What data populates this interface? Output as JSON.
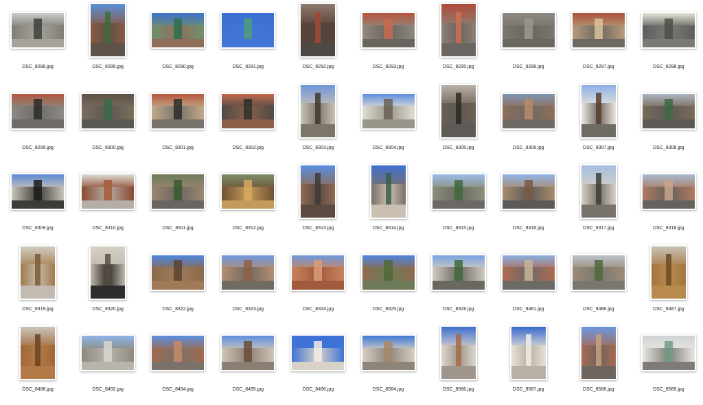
{
  "files": [
    {
      "name": "DSC_8288.jpg",
      "orientation": "land",
      "colors": [
        "#c9c9c6",
        "#7f7e76",
        "#a5a39c"
      ],
      "accent": "#3f3f3a"
    },
    {
      "name": "DSC_8289.jpg",
      "orientation": "port",
      "colors": [
        "#5b8fd6",
        "#8a5a44",
        "#5f5248"
      ],
      "accent": "#3c6e3a"
    },
    {
      "name": "DSC_8290.jpg",
      "orientation": "land",
      "colors": [
        "#3f72c9",
        "#6f8f6f",
        "#8f6f5a"
      ],
      "accent": "#2f6e52"
    },
    {
      "name": "DSC_8291.jpg",
      "orientation": "land",
      "colors": [
        "#3a6fd1",
        "#3f72d3",
        "#4476d6"
      ],
      "accent": "#4d9e7d"
    },
    {
      "name": "DSC_8292.jpg",
      "orientation": "port",
      "colors": [
        "#8d7a70",
        "#5a4236",
        "#4d4844"
      ],
      "accent": "#a24836"
    },
    {
      "name": "DSC_8293.jpg",
      "orientation": "land",
      "colors": [
        "#b5563e",
        "#8f8880",
        "#6a655e"
      ],
      "accent": "#c96b4d"
    },
    {
      "name": "DSC_8295.jpg",
      "orientation": "port",
      "colors": [
        "#b04c38",
        "#8e7f74",
        "#6b6661"
      ],
      "accent": "#d16f4f"
    },
    {
      "name": "DSC_8296.jpg",
      "orientation": "land",
      "colors": [
        "#8c8780",
        "#7a766f",
        "#6a6660"
      ],
      "accent": "#9e988f"
    },
    {
      "name": "DSC_8297.jpg",
      "orientation": "land",
      "colors": [
        "#a9533c",
        "#b59a78",
        "#6d6862"
      ],
      "accent": "#d9c39b"
    },
    {
      "name": "DSC_8298.jpg",
      "orientation": "land",
      "colors": [
        "#e6e2d6",
        "#5c5f5e",
        "#7a7a74"
      ],
      "accent": "#4a5048"
    },
    {
      "name": "DSC_8299.jpg",
      "orientation": "land",
      "colors": [
        "#b1583e",
        "#8c8a84",
        "#6e6b66"
      ],
      "accent": "#2c2c2a"
    },
    {
      "name": "DSC_8300.jpg",
      "orientation": "land",
      "colors": [
        "#5b5246",
        "#7d6d5d",
        "#5a5852"
      ],
      "accent": "#3b6a4a"
    },
    {
      "name": "DSC_8301.jpg",
      "orientation": "land",
      "colors": [
        "#b5583e",
        "#c2a988",
        "#77726b"
      ],
      "accent": "#2e2e2d"
    },
    {
      "name": "DSC_8302.jpg",
      "orientation": "land",
      "colors": [
        "#c0694b",
        "#4e4b45",
        "#8a5f4a"
      ],
      "accent": "#2f2f2c"
    },
    {
      "name": "DSC_8303.jpg",
      "orientation": "port",
      "colors": [
        "#6f96d8",
        "#c8c2b4",
        "#7b7668"
      ],
      "accent": "#3e3a33"
    },
    {
      "name": "DSC_8304.jpg",
      "orientation": "land",
      "colors": [
        "#5f8fe0",
        "#e2ddd3",
        "#9a958b"
      ],
      "accent": "#6b6056"
    },
    {
      "name": "DSC_8305.jpg",
      "orientation": "port",
      "colors": [
        "#b9b2a7",
        "#6a5f52",
        "#5e5a55"
      ],
      "accent": "#2c2a27"
    },
    {
      "name": "DSC_8306.jpg",
      "orientation": "land",
      "colors": [
        "#7e95b3",
        "#8f6e58",
        "#6d6a66"
      ],
      "accent": "#b98a68"
    },
    {
      "name": "DSC_8307.jpg",
      "orientation": "port",
      "colors": [
        "#8fb0e6",
        "#ebe6dc",
        "#6e6a64"
      ],
      "accent": "#59402f"
    },
    {
      "name": "DSC_8308.jpg",
      "orientation": "land",
      "colors": [
        "#a9b3c2",
        "#7a6a58",
        "#5d5a56"
      ],
      "accent": "#3d6a44"
    },
    {
      "name": "DSC_8309.jpg",
      "orientation": "land",
      "colors": [
        "#5d8ad5",
        "#c9c4bb",
        "#3e3c39"
      ],
      "accent": "#1d1d1c"
    },
    {
      "name": "DSC_8310.jpg",
      "orientation": "land",
      "colors": [
        "#dedad4",
        "#8a4a30",
        "#b4aea6"
      ],
      "accent": "#a65a38"
    },
    {
      "name": "DSC_8311.jpg",
      "orientation": "land",
      "colors": [
        "#6e7a5b",
        "#9c8770",
        "#6a6560"
      ],
      "accent": "#3a5a2e"
    },
    {
      "name": "DSC_8312.jpg",
      "orientation": "land",
      "colors": [
        "#7b8d6a",
        "#6e5232",
        "#c49a5a"
      ],
      "accent": "#d6a860"
    },
    {
      "name": "DSC_8313.jpg",
      "orientation": "port",
      "colors": [
        "#5a8fe0",
        "#8f6a54",
        "#5a4a40"
      ],
      "accent": "#3d3a36"
    },
    {
      "name": "DSC_8314.jpg",
      "orientation": "port",
      "colors": [
        "#3f70d0",
        "#7a7066",
        "#c9c0b2"
      ],
      "accent": "#385e48"
    },
    {
      "name": "DSC_8315.jpg",
      "orientation": "land",
      "colors": [
        "#9cbce8",
        "#8a8e7a",
        "#6c6964"
      ],
      "accent": "#3f6a3a"
    },
    {
      "name": "DSC_8316.jpg",
      "orientation": "land",
      "colors": [
        "#8fb4e9",
        "#a88c6c",
        "#5c5a58"
      ],
      "accent": "#7a5a44"
    },
    {
      "name": "DSC_8317.jpg",
      "orientation": "port",
      "colors": [
        "#a4bde0",
        "#d6d0c4",
        "#77726b"
      ],
      "accent": "#3e3c39"
    },
    {
      "name": "DSC_8318.jpg",
      "orientation": "land",
      "colors": [
        "#a7bad3",
        "#b07a5e",
        "#66625e"
      ],
      "accent": "#c8a58c"
    },
    {
      "name": "DSC_8319.jpg",
      "orientation": "port",
      "colors": [
        "#d2ccc2",
        "#a07a48",
        "#c3bbb0"
      ],
      "accent": "#7a5a32"
    },
    {
      "name": "DSC_8320.jpg",
      "orientation": "port",
      "colors": [
        "#d6d0c6",
        "#bfb7aa",
        "#2e2d2b"
      ],
      "accent": "#5b4e42"
    },
    {
      "name": "DSC_8322.jpg",
      "orientation": "land",
      "colors": [
        "#4d86df",
        "#8a6a4c",
        "#a07a58"
      ],
      "accent": "#5b4434"
    },
    {
      "name": "DSC_8323.jpg",
      "orientation": "land",
      "colors": [
        "#6c98de",
        "#b58d72",
        "#6f6a62"
      ],
      "accent": "#8f5f46"
    },
    {
      "name": "DSC_8324.jpg",
      "orientation": "land",
      "colors": [
        "#6f9adf",
        "#c8835d",
        "#a05a3c"
      ],
      "accent": "#d99e78"
    },
    {
      "name": "DSC_8325.jpg",
      "orientation": "land",
      "colors": [
        "#4f86dd",
        "#8f6a4e",
        "#6c7a58"
      ],
      "accent": "#4f6a3a"
    },
    {
      "name": "DSC_8328.jpg",
      "orientation": "land",
      "colors": [
        "#78a3e3",
        "#cfcac0",
        "#6b6862"
      ],
      "accent": "#3f6a3c"
    },
    {
      "name": "DSC_8481.jpg",
      "orientation": "land",
      "colors": [
        "#8ab0e3",
        "#b06a52",
        "#6d6a65"
      ],
      "accent": "#c9b49a"
    },
    {
      "name": "DSC_8486.jpg",
      "orientation": "land",
      "colors": [
        "#b9c3cc",
        "#9c8c76",
        "#7b7770"
      ],
      "accent": "#4e6a3c"
    },
    {
      "name": "DSC_8487.jpg",
      "orientation": "port",
      "colors": [
        "#c8c2b8",
        "#a5753e",
        "#b88a4e"
      ],
      "accent": "#6e4a26"
    },
    {
      "name": "DSC_8488.jpg",
      "orientation": "port",
      "colors": [
        "#cbc5bb",
        "#a0683a",
        "#b27a46"
      ],
      "accent": "#6a4222"
    },
    {
      "name": "DSC_8492.jpg",
      "orientation": "land",
      "colors": [
        "#8fb4e9",
        "#8f8a80",
        "#b9b4ac"
      ],
      "accent": "#d8d6d0"
    },
    {
      "name": "DSC_8494.jpg",
      "orientation": "land",
      "colors": [
        "#5a8fe0",
        "#a06a4e",
        "#7a716a"
      ],
      "accent": "#c58a68"
    },
    {
      "name": "DSC_8495.jpg",
      "orientation": "land",
      "colors": [
        "#5d8fe0",
        "#cfc6b8",
        "#8a7f72"
      ],
      "accent": "#6a4e3a"
    },
    {
      "name": "DSC_8496.jpg",
      "orientation": "land",
      "colors": [
        "#3f72d6",
        "#3f73d8",
        "#d8d2c6"
      ],
      "accent": "#f0ece4"
    },
    {
      "name": "DSC_8584.jpg",
      "orientation": "land",
      "colors": [
        "#3f7ad8",
        "#d6cfc2",
        "#8d857a"
      ],
      "accent": "#a4896c"
    },
    {
      "name": "DSC_8586.jpg",
      "orientation": "port",
      "colors": [
        "#3f6fd1",
        "#ddd6ca",
        "#9e968a"
      ],
      "accent": "#a86a4a"
    },
    {
      "name": "DSC_8587.jpg",
      "orientation": "port",
      "colors": [
        "#3b6ad0",
        "#e6e0d6",
        "#b8b0a4"
      ],
      "accent": "#f1ece4"
    },
    {
      "name": "DSC_8588.jpg",
      "orientation": "port",
      "colors": [
        "#6c98e0",
        "#a86a52",
        "#6d655e"
      ],
      "accent": "#c9a27a"
    },
    {
      "name": "DSC_8589.jpg",
      "orientation": "land",
      "colors": [
        "#cfd3d4",
        "#e8e6e2",
        "#7f7c77"
      ],
      "accent": "#6e9e84"
    }
  ]
}
